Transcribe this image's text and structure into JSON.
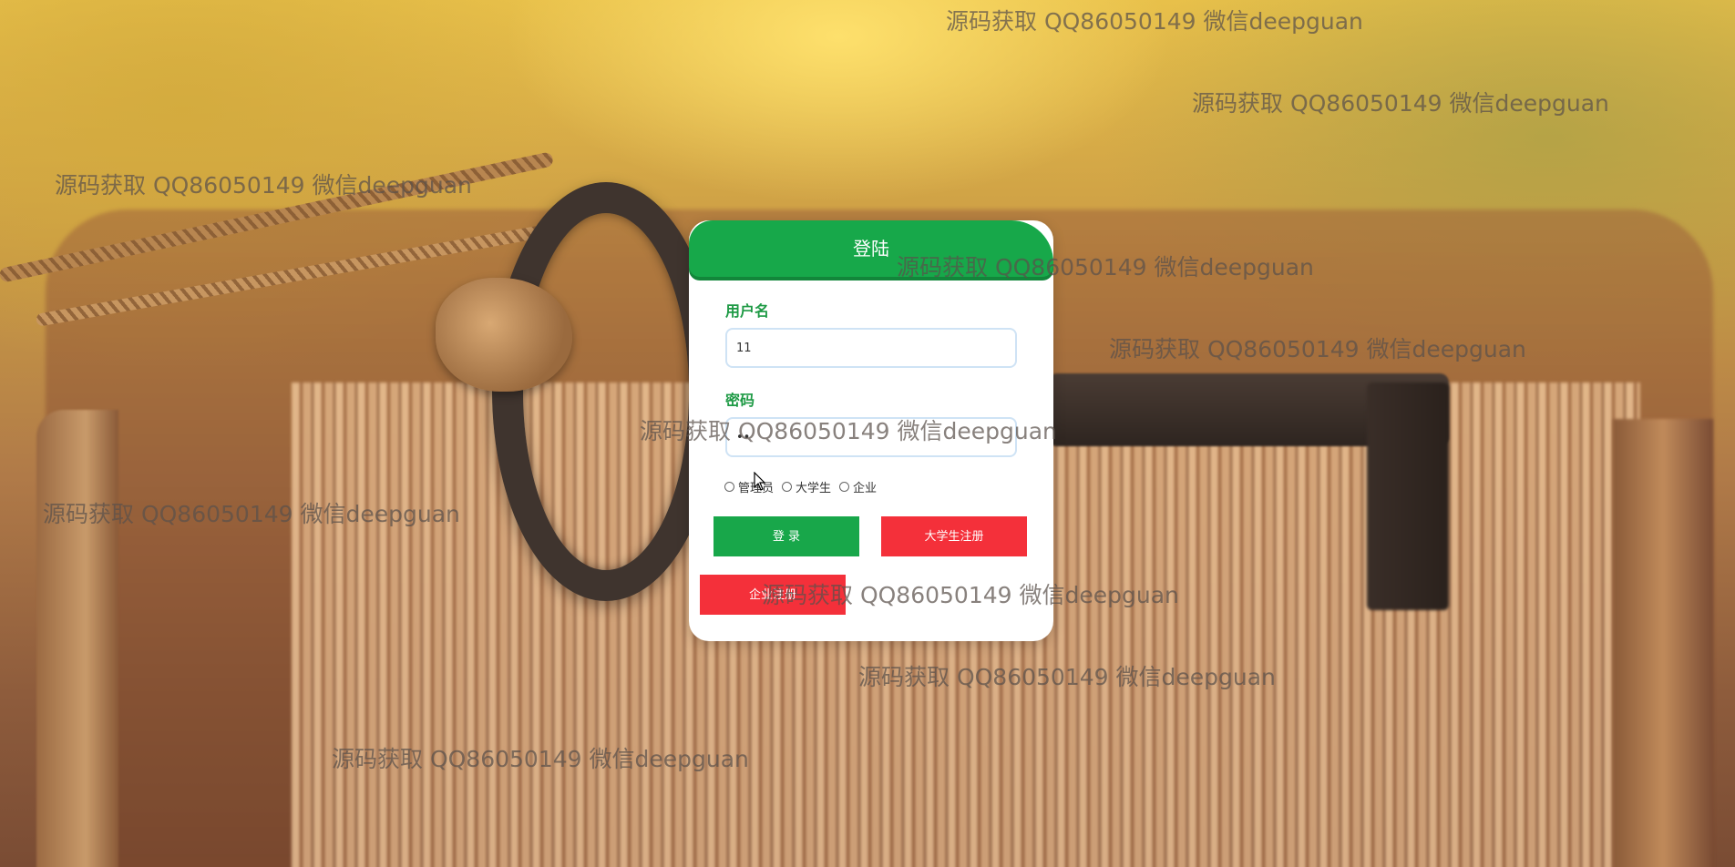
{
  "login": {
    "title": "登陆",
    "username_label": "用户名",
    "username_value": "11",
    "password_label": "密码",
    "password_value": "••",
    "roles": [
      "管理员",
      "大学生",
      "企业"
    ],
    "login_button": "登 录",
    "student_register_button": "大学生注册",
    "company_register_button": "企业注册"
  },
  "watermark": {
    "text": "源码获取 QQ86050149 微信deepguan"
  },
  "colors": {
    "accent_green": "#17a84a",
    "register_red": "#f4303a"
  }
}
